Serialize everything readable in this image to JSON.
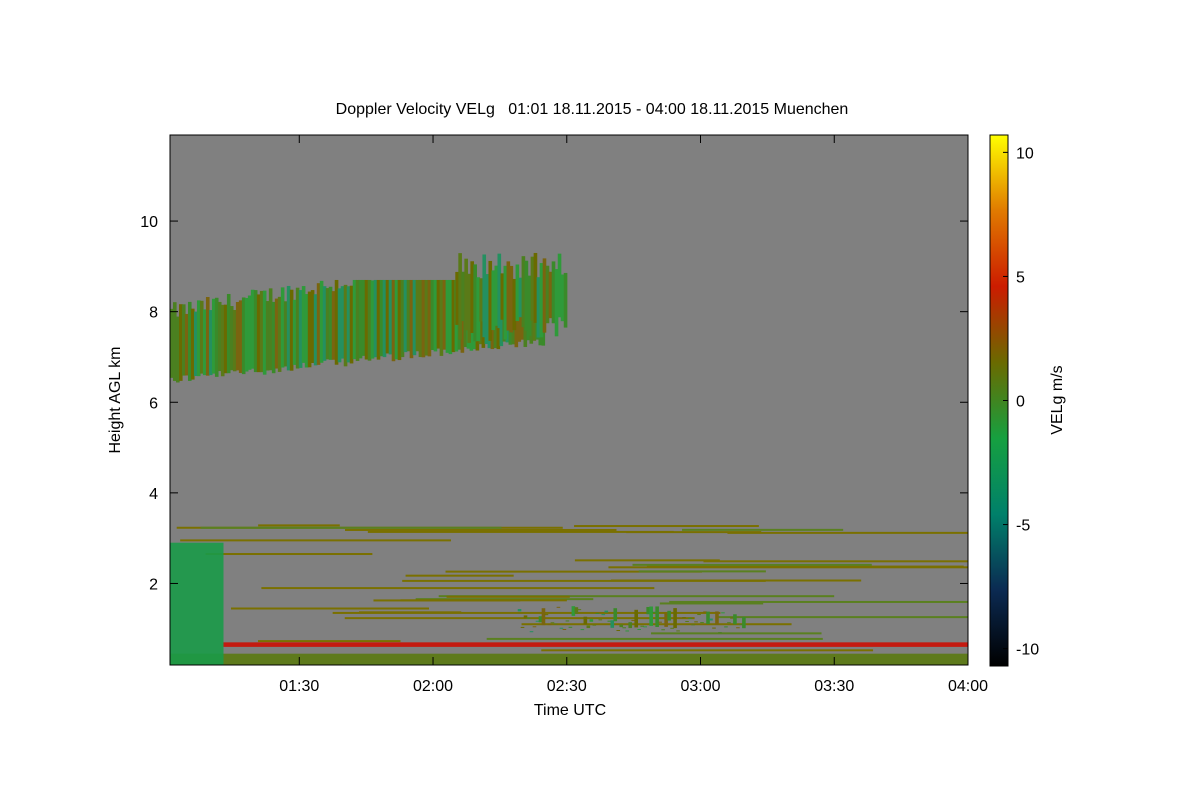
{
  "chart_data": {
    "type": "heatmap",
    "title": "Doppler Velocity VELg   01:01 18.11.2015 - 04:00 18.11.2015 Muenchen",
    "xlabel": "Time UTC",
    "ylabel": "Height AGL km",
    "colorbar_label": "VELg m/s",
    "x_range": [
      "01:01",
      "04:00"
    ],
    "x_ticks": [
      "01:30",
      "02:00",
      "02:30",
      "03:00",
      "03:30",
      "04:00"
    ],
    "y_range": [
      0.2,
      11.9
    ],
    "y_ticks": [
      2,
      4,
      6,
      8,
      10
    ],
    "colorbar_range": [
      -10.7,
      10.7
    ],
    "colorbar_ticks": [
      10,
      5,
      0,
      -5,
      -10
    ],
    "colorbar_colors": [
      "#000000",
      "#0b2a52",
      "#00806a",
      "#16a040",
      "#6a6a00",
      "#cc1c00",
      "#e07a00",
      "#ffff00"
    ],
    "background_color": "#808080",
    "features": [
      {
        "name": "upper cloud layer",
        "time_start": "01:01",
        "time_end": "02:25",
        "height_km": [
          6.3,
          8.7
        ],
        "velocity_ms": [
          -2,
          2
        ]
      },
      {
        "name": "upper cloud fragments",
        "time_start": "02:05",
        "time_end": "02:30",
        "height_km": [
          7.3,
          9.3
        ],
        "velocity_ms": [
          -1,
          3
        ]
      },
      {
        "name": "boundary layer returns",
        "time_start": "01:01",
        "time_end": "04:00",
        "height_km": [
          0.2,
          3.5
        ],
        "velocity_ms": [
          -3,
          3
        ]
      },
      {
        "name": "low-level band",
        "time_start": "02:19",
        "time_end": "03:10",
        "height_km": [
          1.0,
          1.5
        ],
        "velocity_ms": [
          -2,
          1
        ]
      },
      {
        "name": "near-surface red line",
        "time_start": "01:13",
        "time_end": "04:00",
        "height_km": [
          0.6,
          0.7
        ],
        "velocity_ms": [
          2,
          3
        ]
      }
    ]
  }
}
